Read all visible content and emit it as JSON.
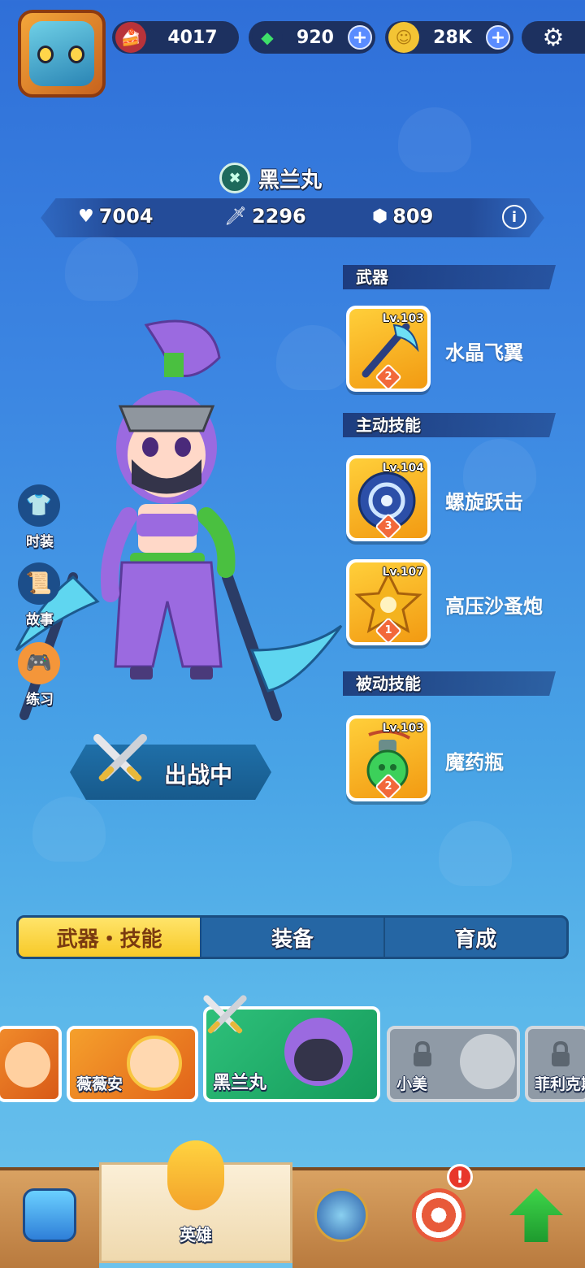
{
  "resources": {
    "cake": "4017",
    "gems": "920",
    "coins": "28K"
  },
  "hero": {
    "name": "黑兰丸",
    "stats": {
      "health": "7004",
      "attack": "2296",
      "defense": "809"
    }
  },
  "sections": {
    "weapon": "武器",
    "active": "主动技能",
    "passive": "被动技能"
  },
  "skills": [
    {
      "level": "Lv.103",
      "stars": "2",
      "name": "水晶飞翼"
    },
    {
      "level": "Lv.104",
      "stars": "3",
      "name": "螺旋跃击"
    },
    {
      "level": "Lv.107",
      "stars": "1",
      "name": "高压沙蚤炮"
    },
    {
      "level": "Lv.103",
      "stars": "2",
      "name": "魔药瓶"
    }
  ],
  "side_buttons": {
    "fashion": "时装",
    "story": "故事",
    "practice": "练习"
  },
  "battle_status": "出战中",
  "tabs": {
    "weapon_skill": "武器・技能",
    "equipment": "装备",
    "develop": "育成"
  },
  "hero_cards": {
    "c1": "薇薇安",
    "c2": "黑兰丸",
    "c3": "小美",
    "c4": "菲利克斯"
  },
  "nav": {
    "hero": "英雄",
    "alert": "!"
  },
  "colors": {
    "accent_yellow": "#f7c928",
    "panel_blue": "#1d3160",
    "selected_green": "#159b5b"
  }
}
